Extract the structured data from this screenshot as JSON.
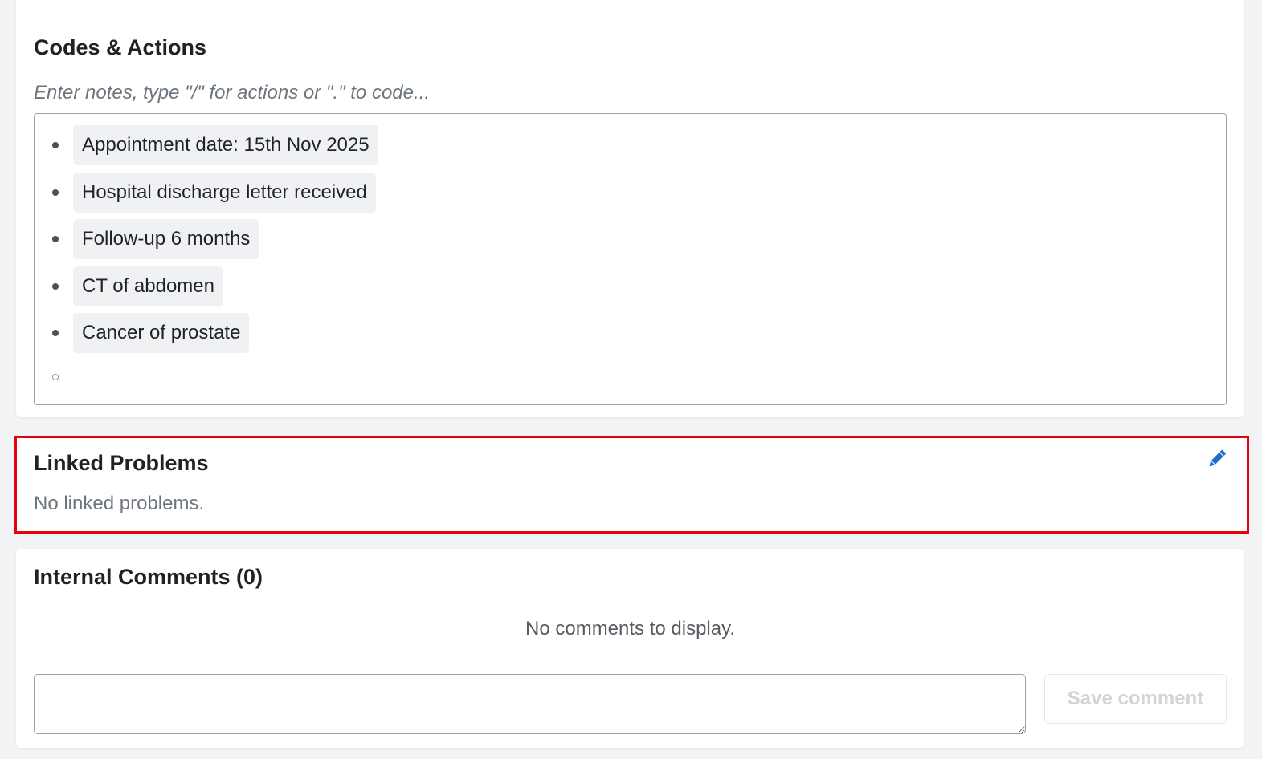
{
  "codes_actions": {
    "title": "Codes & Actions",
    "hint": "Enter notes, type \"/\" for actions or \".\" to code...",
    "items": [
      {
        "label": "Appointment date: 15th Nov 2025"
      },
      {
        "label": "Hospital discharge letter received"
      },
      {
        "label": "Follow-up 6 months"
      },
      {
        "label": "CT of abdomen"
      },
      {
        "label": "Cancer of prostate"
      }
    ]
  },
  "linked_problems": {
    "title": "Linked Problems",
    "empty_text": "No linked problems.",
    "edit_icon": "pencil-icon",
    "highlight_color": "#e8000d",
    "icon_color": "#1a6fd1"
  },
  "internal_comments": {
    "title": "Internal Comments (0)",
    "empty_text": "No comments to display.",
    "input_value": "",
    "save_label": "Save comment"
  }
}
